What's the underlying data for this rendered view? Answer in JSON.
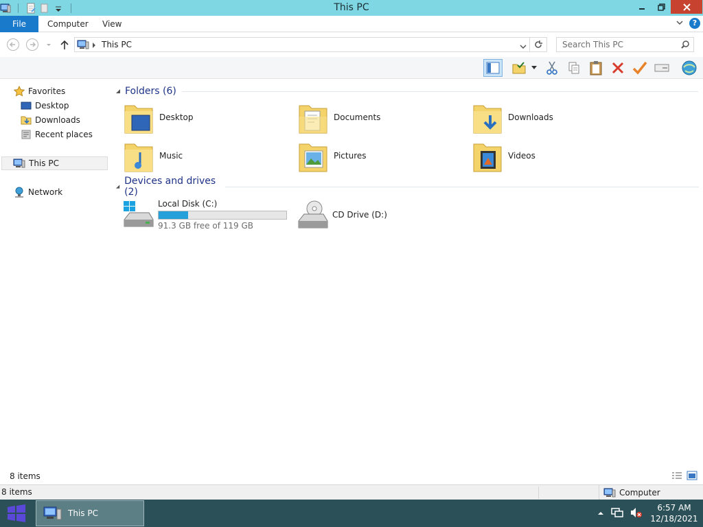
{
  "window": {
    "title": "This PC"
  },
  "ribbon": {
    "tabs": [
      "File",
      "Computer",
      "View"
    ]
  },
  "address": {
    "breadcrumb": "This PC",
    "search_placeholder": "Search This PC"
  },
  "nav": {
    "favorites": "Favorites",
    "desktop": "Desktop",
    "downloads": "Downloads",
    "recent": "Recent places",
    "this_pc": "This PC",
    "network": "Network"
  },
  "content": {
    "folders_header": "Folders (6)",
    "folders": [
      "Desktop",
      "Documents",
      "Downloads",
      "Music",
      "Pictures",
      "Videos"
    ],
    "devices_header": "Devices and drives (2)",
    "drives": [
      {
        "name": "Local Disk (C:)",
        "free": "91.3 GB free of 119 GB",
        "used_fraction": 0.233
      },
      {
        "name": "CD Drive (D:)"
      }
    ]
  },
  "status": {
    "items": "8 items",
    "outer_items": "8 items",
    "zone": "Computer"
  },
  "taskbar": {
    "task": "This PC",
    "time": "6:57 AM",
    "date": "12/18/2021"
  },
  "colors": {
    "titlebar": "#7fd7e3",
    "accent": "#1979ca",
    "taskbar": "#2c5058",
    "drive_bar": "#26a0da",
    "group_header": "#1e3287"
  }
}
